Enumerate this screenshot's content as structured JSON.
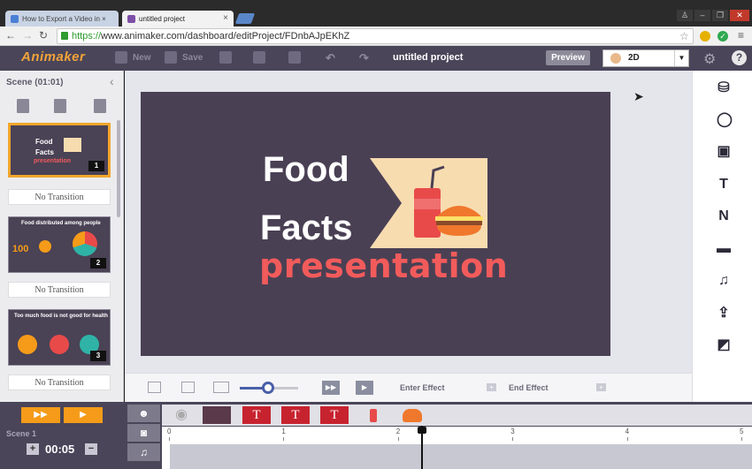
{
  "browser": {
    "tabs": [
      {
        "title": "How to Export a Video in ×",
        "active": false
      },
      {
        "title": "untitled project",
        "active": true
      }
    ],
    "url_scheme": "https://",
    "url_rest": "www.animaker.com/dashboard/editProject/FDnbAJpEKhZ"
  },
  "toolbar": {
    "logo": "Animaker",
    "new_label": "New",
    "save_label": "Save",
    "project_title": "untitled project",
    "preview_label": "Preview",
    "mode_value": "2D",
    "help_label": "?"
  },
  "scenes": {
    "header": "Scene  (01:01)",
    "items": [
      {
        "number": "1",
        "transition": "No Transition",
        "line1": "Food",
        "line2": "Facts",
        "line3": "presentation"
      },
      {
        "number": "2",
        "transition": "No Transition",
        "line1": "Food distributed among people",
        "line2": "100"
      },
      {
        "number": "3",
        "transition": "No Transition",
        "line1": "Too much food is not good for health"
      }
    ]
  },
  "canvas": {
    "line1": "Food",
    "line2": "Facts",
    "line3": "presentation",
    "colors": {
      "background": "#4a4054",
      "title": "#ffffff",
      "accent": "#f25b5b",
      "banner": "#f7dcb0"
    }
  },
  "stage_controls": {
    "zoom_fraction": 0.48,
    "enter_effect": "Enter Effect",
    "end_effect": "End Effect"
  },
  "right_sidebar": {
    "icons": [
      "character-icon",
      "property-icon",
      "image-icon",
      "text-icon",
      "number-icon",
      "background-icon",
      "music-icon",
      "upload-icon",
      "transition-icon"
    ]
  },
  "timeline": {
    "scene_label": "Scene  1",
    "duration": "00:05",
    "minus": "−",
    "plus": "+",
    "ticks": [
      "0",
      "1",
      "2",
      "3",
      "4",
      "5"
    ],
    "text_item": "T",
    "playhead_seconds": 2.2,
    "accent": "#f59b19"
  }
}
